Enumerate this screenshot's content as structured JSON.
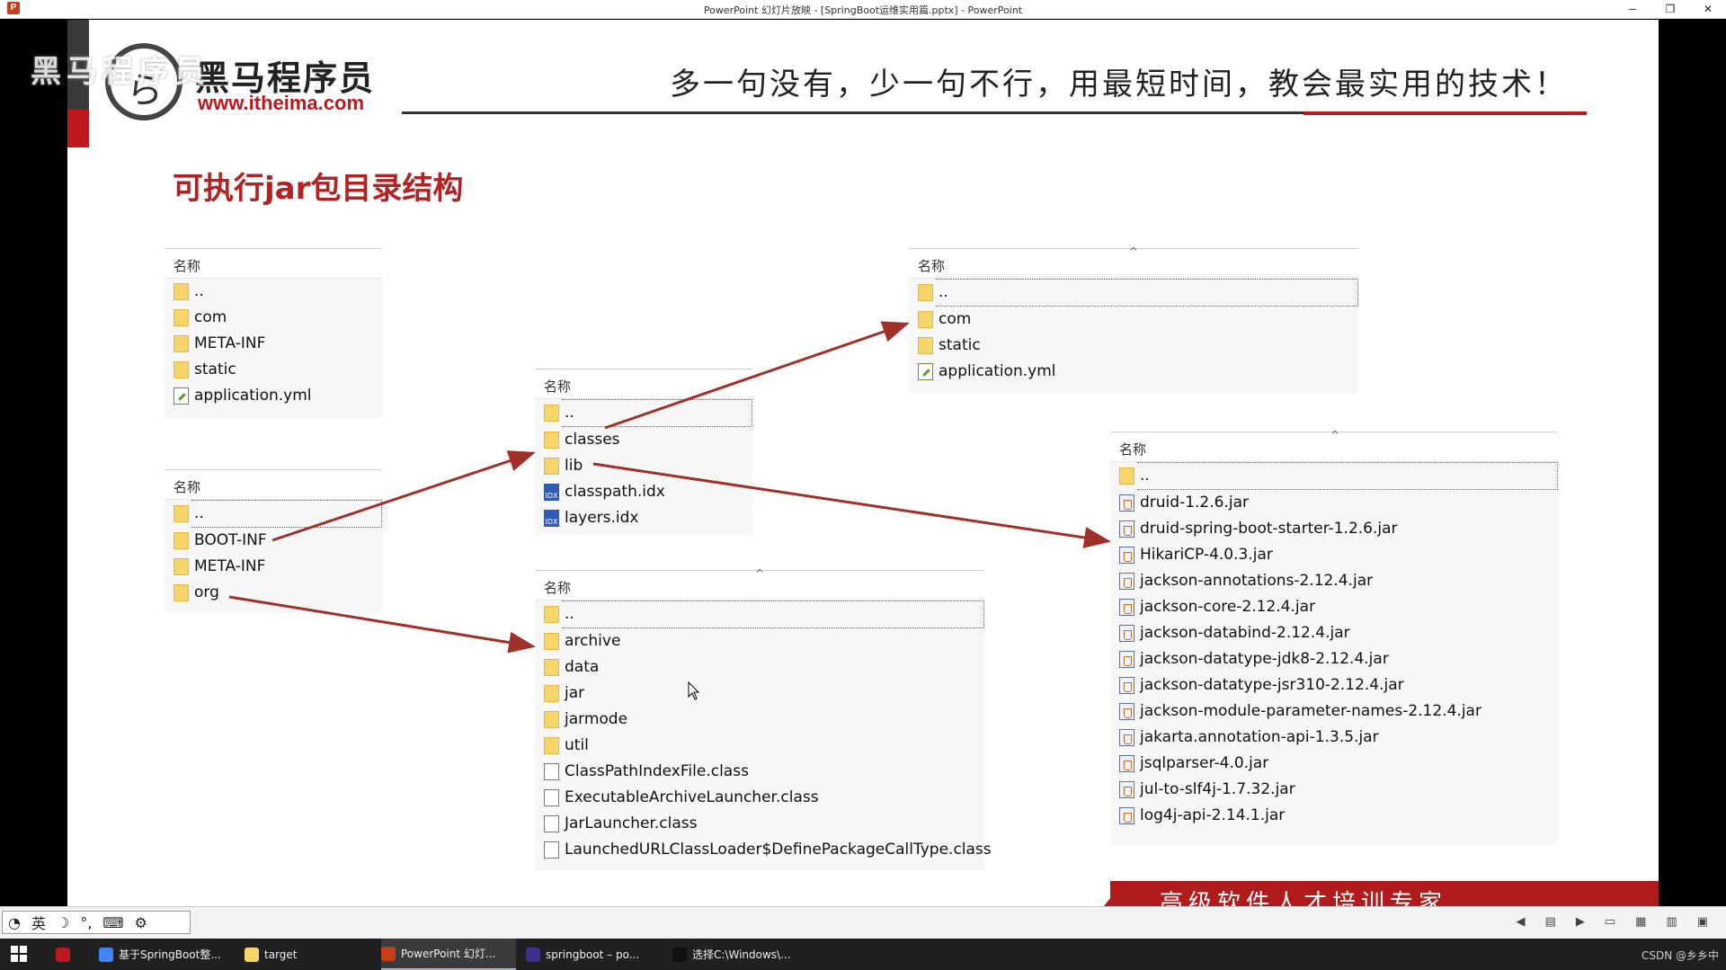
{
  "window": {
    "title": "PowerPoint 幻灯片放映 - [SpringBoot运维实用篇.pptx] - PowerPoint",
    "minimize": "─",
    "restore": "❐",
    "close": "✕"
  },
  "slide": {
    "watermark": "黑马程序员",
    "logo_name": "黑马程序员",
    "logo_url": "www.itheima.com",
    "slogan": "多一句没有，少一句不行，用最短时间，教会最实用的技术！",
    "title": "可执行jar包目录结构",
    "banner": "高级软件人才培训专家"
  },
  "panels": {
    "root": {
      "header": "名称",
      "items": [
        {
          "type": "folder",
          "name": ".."
        },
        {
          "type": "folder",
          "name": "com"
        },
        {
          "type": "folder",
          "name": "META-INF"
        },
        {
          "type": "folder",
          "name": "static"
        },
        {
          "type": "yml",
          "name": "application.yml"
        }
      ]
    },
    "jar_root": {
      "header": "名称",
      "items": [
        {
          "type": "folder",
          "name": ".."
        },
        {
          "type": "folder",
          "name": "BOOT-INF"
        },
        {
          "type": "folder",
          "name": "META-INF"
        },
        {
          "type": "folder",
          "name": "org"
        }
      ]
    },
    "boot_inf": {
      "header": "名称",
      "items": [
        {
          "type": "folder",
          "name": ".."
        },
        {
          "type": "folder",
          "name": "classes"
        },
        {
          "type": "folder",
          "name": "lib"
        },
        {
          "type": "idx",
          "name": "classpath.idx"
        },
        {
          "type": "idx",
          "name": "layers.idx"
        }
      ]
    },
    "classes": {
      "header": "名称",
      "items": [
        {
          "type": "folder",
          "name": ".."
        },
        {
          "type": "folder",
          "name": "com"
        },
        {
          "type": "folder",
          "name": "static"
        },
        {
          "type": "yml",
          "name": "application.yml"
        }
      ]
    },
    "org": {
      "header": "名称",
      "items": [
        {
          "type": "folder",
          "name": ".."
        },
        {
          "type": "folder",
          "name": "archive"
        },
        {
          "type": "folder",
          "name": "data"
        },
        {
          "type": "folder",
          "name": "jar"
        },
        {
          "type": "folder",
          "name": "jarmode"
        },
        {
          "type": "folder",
          "name": "util"
        },
        {
          "type": "file",
          "name": "ClassPathIndexFile.class"
        },
        {
          "type": "file",
          "name": "ExecutableArchiveLauncher.class"
        },
        {
          "type": "file",
          "name": "JarLauncher.class"
        },
        {
          "type": "file",
          "name": "LaunchedURLClassLoader$DefinePackageCallType.class"
        }
      ]
    },
    "lib": {
      "header": "名称",
      "items": [
        {
          "type": "folder",
          "name": ".."
        },
        {
          "type": "jar",
          "name": "druid-1.2.6.jar"
        },
        {
          "type": "jar",
          "name": "druid-spring-boot-starter-1.2.6.jar"
        },
        {
          "type": "jar",
          "name": "HikariCP-4.0.3.jar"
        },
        {
          "type": "jar",
          "name": "jackson-annotations-2.12.4.jar"
        },
        {
          "type": "jar",
          "name": "jackson-core-2.12.4.jar"
        },
        {
          "type": "jar",
          "name": "jackson-databind-2.12.4.jar"
        },
        {
          "type": "jar",
          "name": "jackson-datatype-jdk8-2.12.4.jar"
        },
        {
          "type": "jar",
          "name": "jackson-datatype-jsr310-2.12.4.jar"
        },
        {
          "type": "jar",
          "name": "jackson-module-parameter-names-2.12.4.jar"
        },
        {
          "type": "jar",
          "name": "jakarta.annotation-api-1.3.5.jar"
        },
        {
          "type": "jar",
          "name": "jsqlparser-4.0.jar"
        },
        {
          "type": "jar",
          "name": "jul-to-slf4j-1.7.32.jar"
        },
        {
          "type": "jar",
          "name": "log4j-api-2.14.1.jar"
        }
      ]
    }
  },
  "statusbar": {
    "ime_lang": "英",
    "ime_moon": "☽",
    "ime_punct": "°,",
    "ime_keyboard": "⌨",
    "ime_settings": "⚙"
  },
  "taskbar": {
    "items": [
      {
        "label": "基于SpringBoot整...",
        "color": "#4285f4"
      },
      {
        "label": "target",
        "color": "#f8d56a"
      },
      {
        "label": "PowerPoint 幻灯...",
        "color": "#c43e1c"
      },
      {
        "label": "springboot – po...",
        "color": "#3d2f8c"
      },
      {
        "label": "选择C:\\Windows\\...",
        "color": "#111111"
      }
    ],
    "tray_text": "CSDN @乡乡中"
  },
  "colors": {
    "accent_red": "#c0171c",
    "arrow": "#a0302a"
  }
}
